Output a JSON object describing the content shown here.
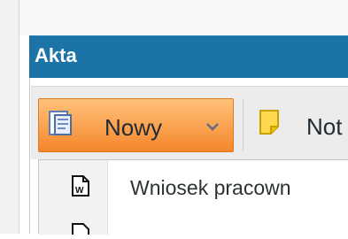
{
  "panel": {
    "title": "Akta"
  },
  "toolbar": {
    "new_label": "Nowy",
    "new_icon": "word-document-icon",
    "dropdown_icon": "chevron-down-icon",
    "note_label": "Not",
    "note_icon": "sticky-note-icon"
  },
  "dropdown": {
    "items": [
      {
        "label": "Wniosek pracown",
        "icon": "word-file-icon"
      },
      {
        "label": "",
        "icon": "document-icon"
      }
    ]
  },
  "colors": {
    "header_bg": "#1c73a8",
    "header_text": "#ffffff",
    "button_active_bg": "#f5862b",
    "toolbar_bg": "#ececec"
  }
}
